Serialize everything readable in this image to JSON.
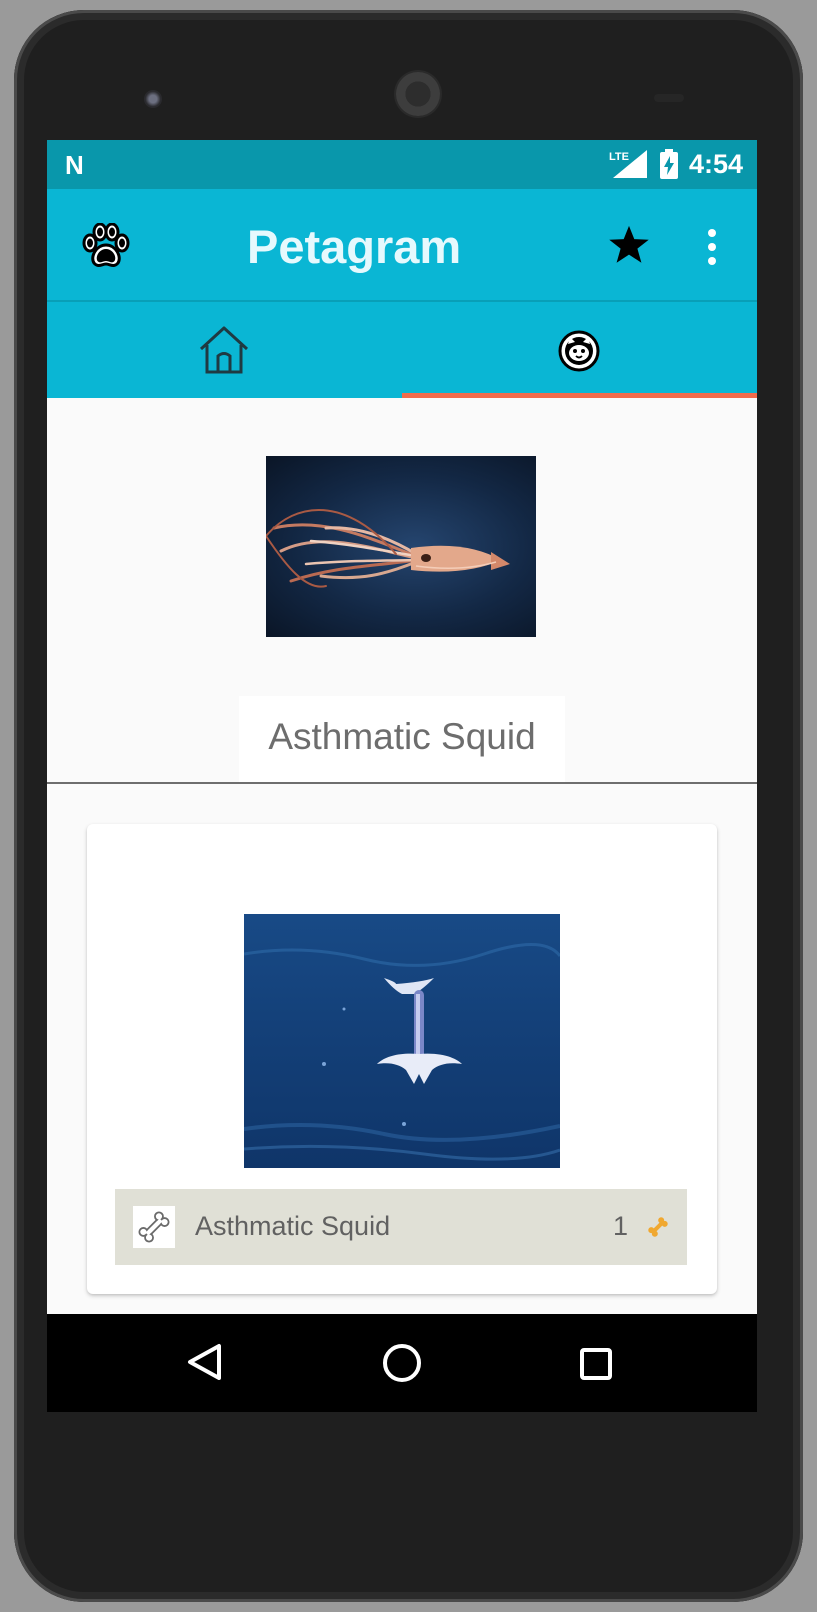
{
  "status_bar": {
    "network_letter": "N",
    "lte_label": "LTE",
    "time": "4:54"
  },
  "app_bar": {
    "title": "Petagram",
    "nav_icon": "paw-icon",
    "favorites_icon": "star-icon",
    "menu_icon": "overflow-menu-icon"
  },
  "tabs": [
    {
      "icon": "home-icon",
      "selected": false
    },
    {
      "icon": "pet-face-icon",
      "selected": true
    }
  ],
  "colors": {
    "status_bar": "#0997ab",
    "app_bar": "#0ab6d4",
    "tab_indicator": "#f26b4b",
    "card_footer": "#e0e0d6"
  },
  "profile": {
    "name": "Asthmatic Squid"
  },
  "posts": [
    {
      "name": "Asthmatic Squid",
      "likes": "1"
    }
  ],
  "system_nav": {
    "back_icon": "back-triangle-icon",
    "home_icon": "home-circle-icon",
    "recents_icon": "recents-square-icon"
  }
}
